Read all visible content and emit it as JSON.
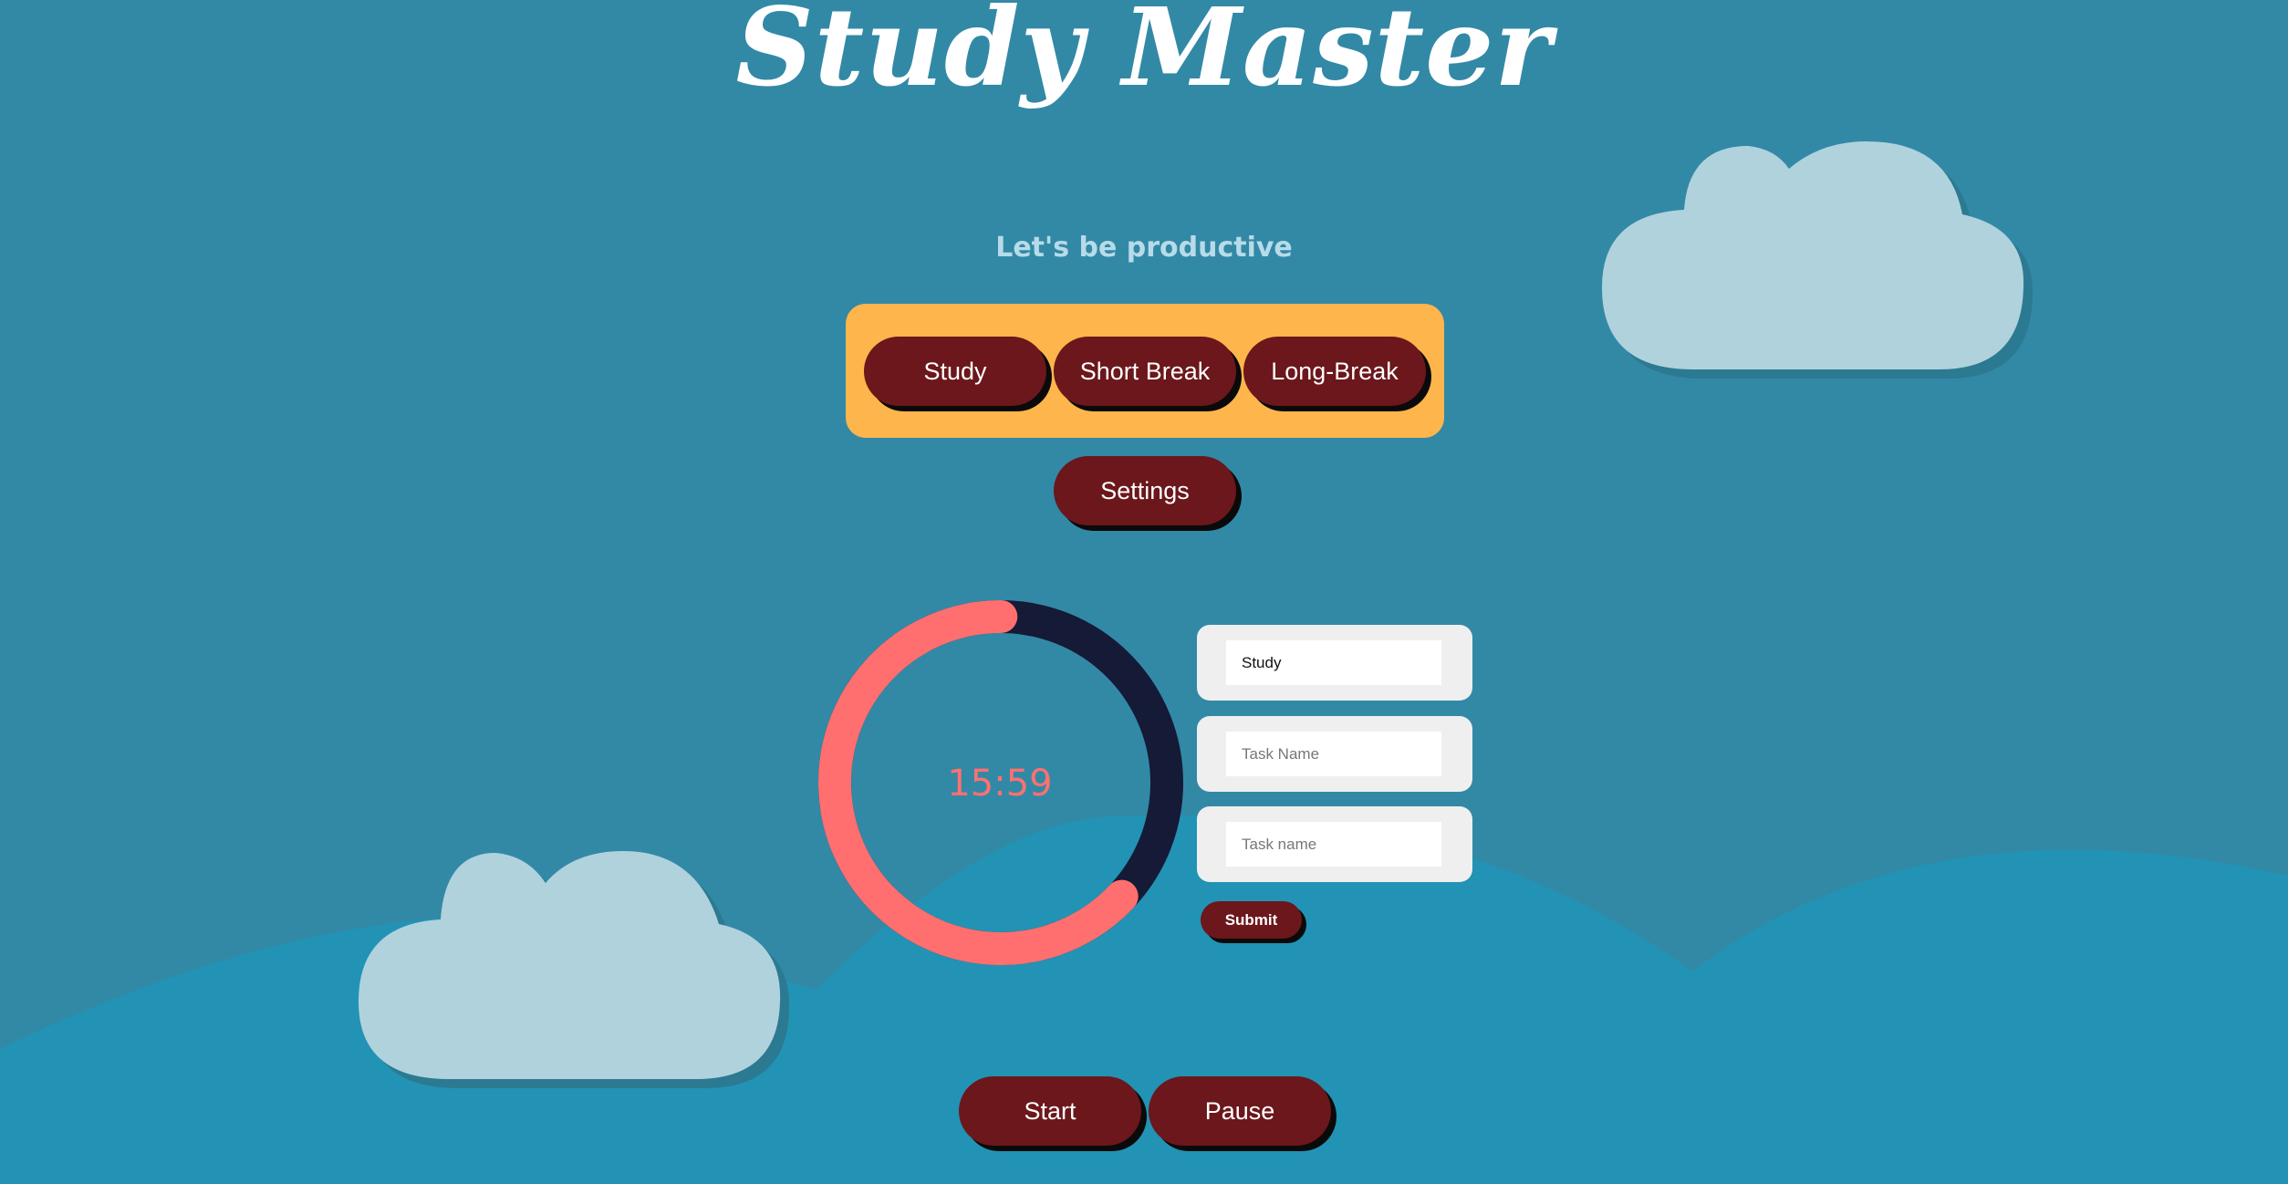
{
  "app": {
    "title": "Study Master",
    "subtitle": "Let's be productive"
  },
  "modes": [
    {
      "label": "Study"
    },
    {
      "label": "Short Break"
    },
    {
      "label": "Long-Break"
    }
  ],
  "settings_label": "Settings",
  "timer": {
    "display": "15:59",
    "progress_fraction": 0.63
  },
  "form": {
    "fields": [
      {
        "value": "Study",
        "placeholder": ""
      },
      {
        "value": "",
        "placeholder": "Task Name"
      },
      {
        "value": "",
        "placeholder": "Task name"
      }
    ],
    "submit_label": "Submit"
  },
  "controls": {
    "start_label": "Start",
    "pause_label": "Pause"
  },
  "colors": {
    "background": "#3289a6",
    "hills": "#2293b4",
    "cloud": "#b0d2dd",
    "panel": "#feb54c",
    "button": "#6b171b",
    "ring_progress": "#ff6f6f",
    "ring_track": "#151a36",
    "timer_text": "#ff7070"
  }
}
